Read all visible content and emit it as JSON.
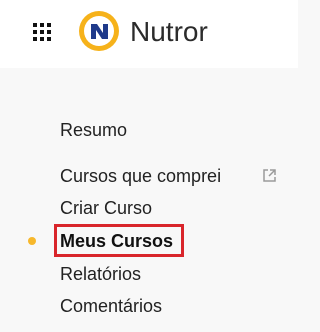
{
  "header": {
    "brand_name": "Nutror",
    "apps_icon": "grid-apps-icon",
    "logo_icon": "nutror-logo"
  },
  "menu": {
    "items": [
      {
        "label": "Resumo",
        "active": false
      },
      {
        "label": "Cursos que comprei",
        "active": false,
        "icon": "external-link-icon"
      },
      {
        "label": "Criar Curso",
        "active": false
      },
      {
        "label": "Meus Cursos",
        "active": true
      },
      {
        "label": "Relatórios",
        "active": false
      },
      {
        "label": "Comentários",
        "active": false
      }
    ]
  },
  "colors": {
    "background": "#f8f8f8",
    "header": "#ffffff",
    "highlight_border": "#d9252b",
    "active_dot": "#f7b82c",
    "logo_blue": "#1f3a8a",
    "logo_yellow": "#f6b21a"
  }
}
